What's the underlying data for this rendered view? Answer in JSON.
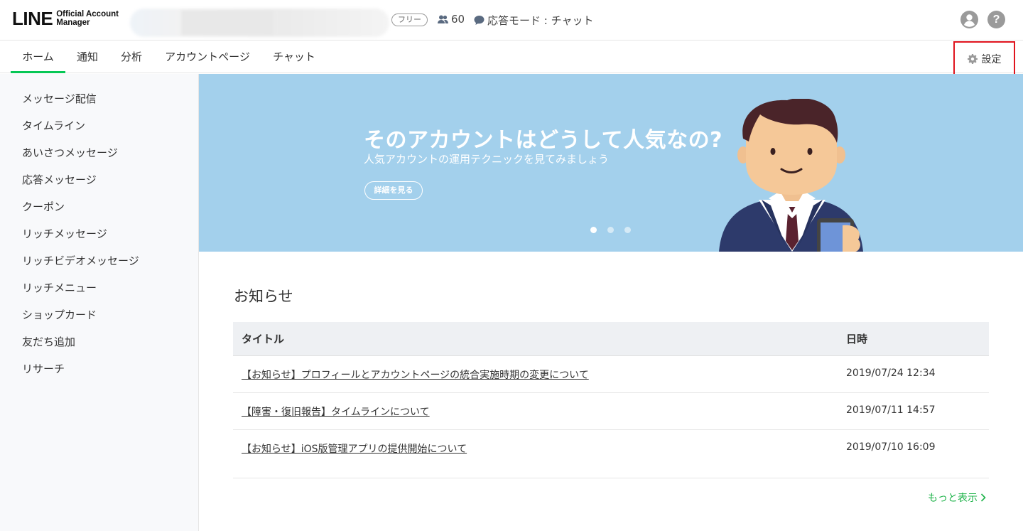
{
  "header": {
    "logo_main": "LINE",
    "logo_sub_line1": "Official Account",
    "logo_sub_line2": "Manager",
    "plan_badge": "フリー",
    "friends_count": "60",
    "response_mode": "応答モード : チャット"
  },
  "nav": {
    "tabs": [
      "ホーム",
      "通知",
      "分析",
      "アカウントページ",
      "チャット"
    ],
    "active_tab": "ホーム",
    "settings_label": "設定"
  },
  "sidebar": {
    "items": [
      "メッセージ配信",
      "タイムライン",
      "あいさつメッセージ",
      "応答メッセージ",
      "クーポン",
      "リッチメッセージ",
      "リッチビデオメッセージ",
      "リッチメニュー",
      "ショップカード",
      "友だち追加",
      "リサーチ"
    ]
  },
  "banner": {
    "title": "そのアカウントはどうして人気なの?",
    "subtitle": "人気アカウントの運用テクニックを見てみましょう",
    "button": "詳細を見る",
    "slide_count": 3,
    "active_slide": 1
  },
  "notices": {
    "heading": "お知らせ",
    "columns": [
      "タイトル",
      "日時"
    ],
    "rows": [
      {
        "title": "【お知らせ】プロフィールとアカウントページの統合実施時期の変更について",
        "date": "2019/07/24 12:34"
      },
      {
        "title": "【障害・復旧報告】タイムラインについて",
        "date": "2019/07/11 14:57"
      },
      {
        "title": "【お知らせ】iOS版管理アプリの提供開始について",
        "date": "2019/07/10 16:09"
      }
    ],
    "more": "もっと表示"
  },
  "colors": {
    "accent_green": "#06c755",
    "link_green": "#1eb34a",
    "banner_bg": "#a3d0ec",
    "highlight_red": "#e0141e"
  }
}
